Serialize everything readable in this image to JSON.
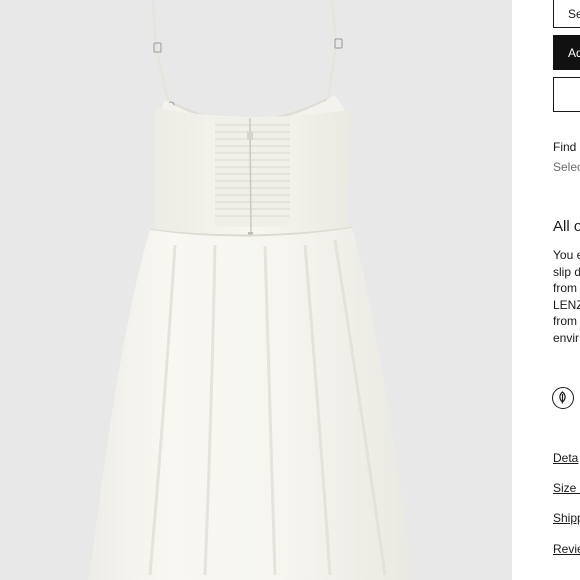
{
  "product": {
    "image_alt": "dress-image"
  },
  "actions": {
    "select_size_label": "Se",
    "add_to_bag_label": "Ad",
    "wishlist_label": ""
  },
  "store": {
    "find_label": "Find i",
    "select_store_label": "Selec"
  },
  "description": {
    "heading": "All o",
    "lines": [
      "You e",
      "slip d",
      "from",
      "LENZ",
      "from",
      "envir"
    ]
  },
  "eco_badge": {
    "icon": "eco-leaf-icon"
  },
  "links": {
    "details": "Deta",
    "size": "Size &",
    "shipping": "Shipp",
    "reviews": "Revie"
  },
  "colors": {
    "image_background": "#e8e8e8",
    "dress": "#f7f6f1",
    "button_dark": "#111111"
  }
}
